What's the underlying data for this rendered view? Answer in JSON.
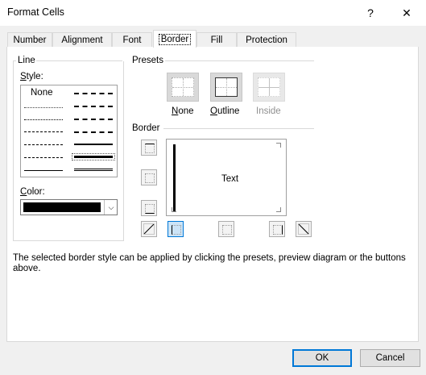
{
  "window": {
    "title": "Format Cells",
    "help_glyph": "?",
    "close_glyph": "✕"
  },
  "tabs": [
    {
      "label": "Number"
    },
    {
      "label": "Alignment"
    },
    {
      "label": "Font"
    },
    {
      "label": "Border",
      "active": true
    },
    {
      "label": "Fill"
    },
    {
      "label": "Protection"
    }
  ],
  "line_group": {
    "title": "Line",
    "style_label": "Style:",
    "none_label": "None",
    "color_label": "Color:",
    "selected_color": "#000000"
  },
  "presets_group": {
    "title": "Presets",
    "items": [
      {
        "label": "None",
        "enabled": true
      },
      {
        "label": "Outline",
        "enabled": true
      },
      {
        "label": "Inside",
        "enabled": false
      }
    ]
  },
  "border_group": {
    "title": "Border",
    "preview_text": "Text"
  },
  "hint": "The selected border style can be applied by clicking the presets, preview diagram or the buttons above.",
  "buttons": {
    "ok": "OK",
    "cancel": "Cancel"
  }
}
